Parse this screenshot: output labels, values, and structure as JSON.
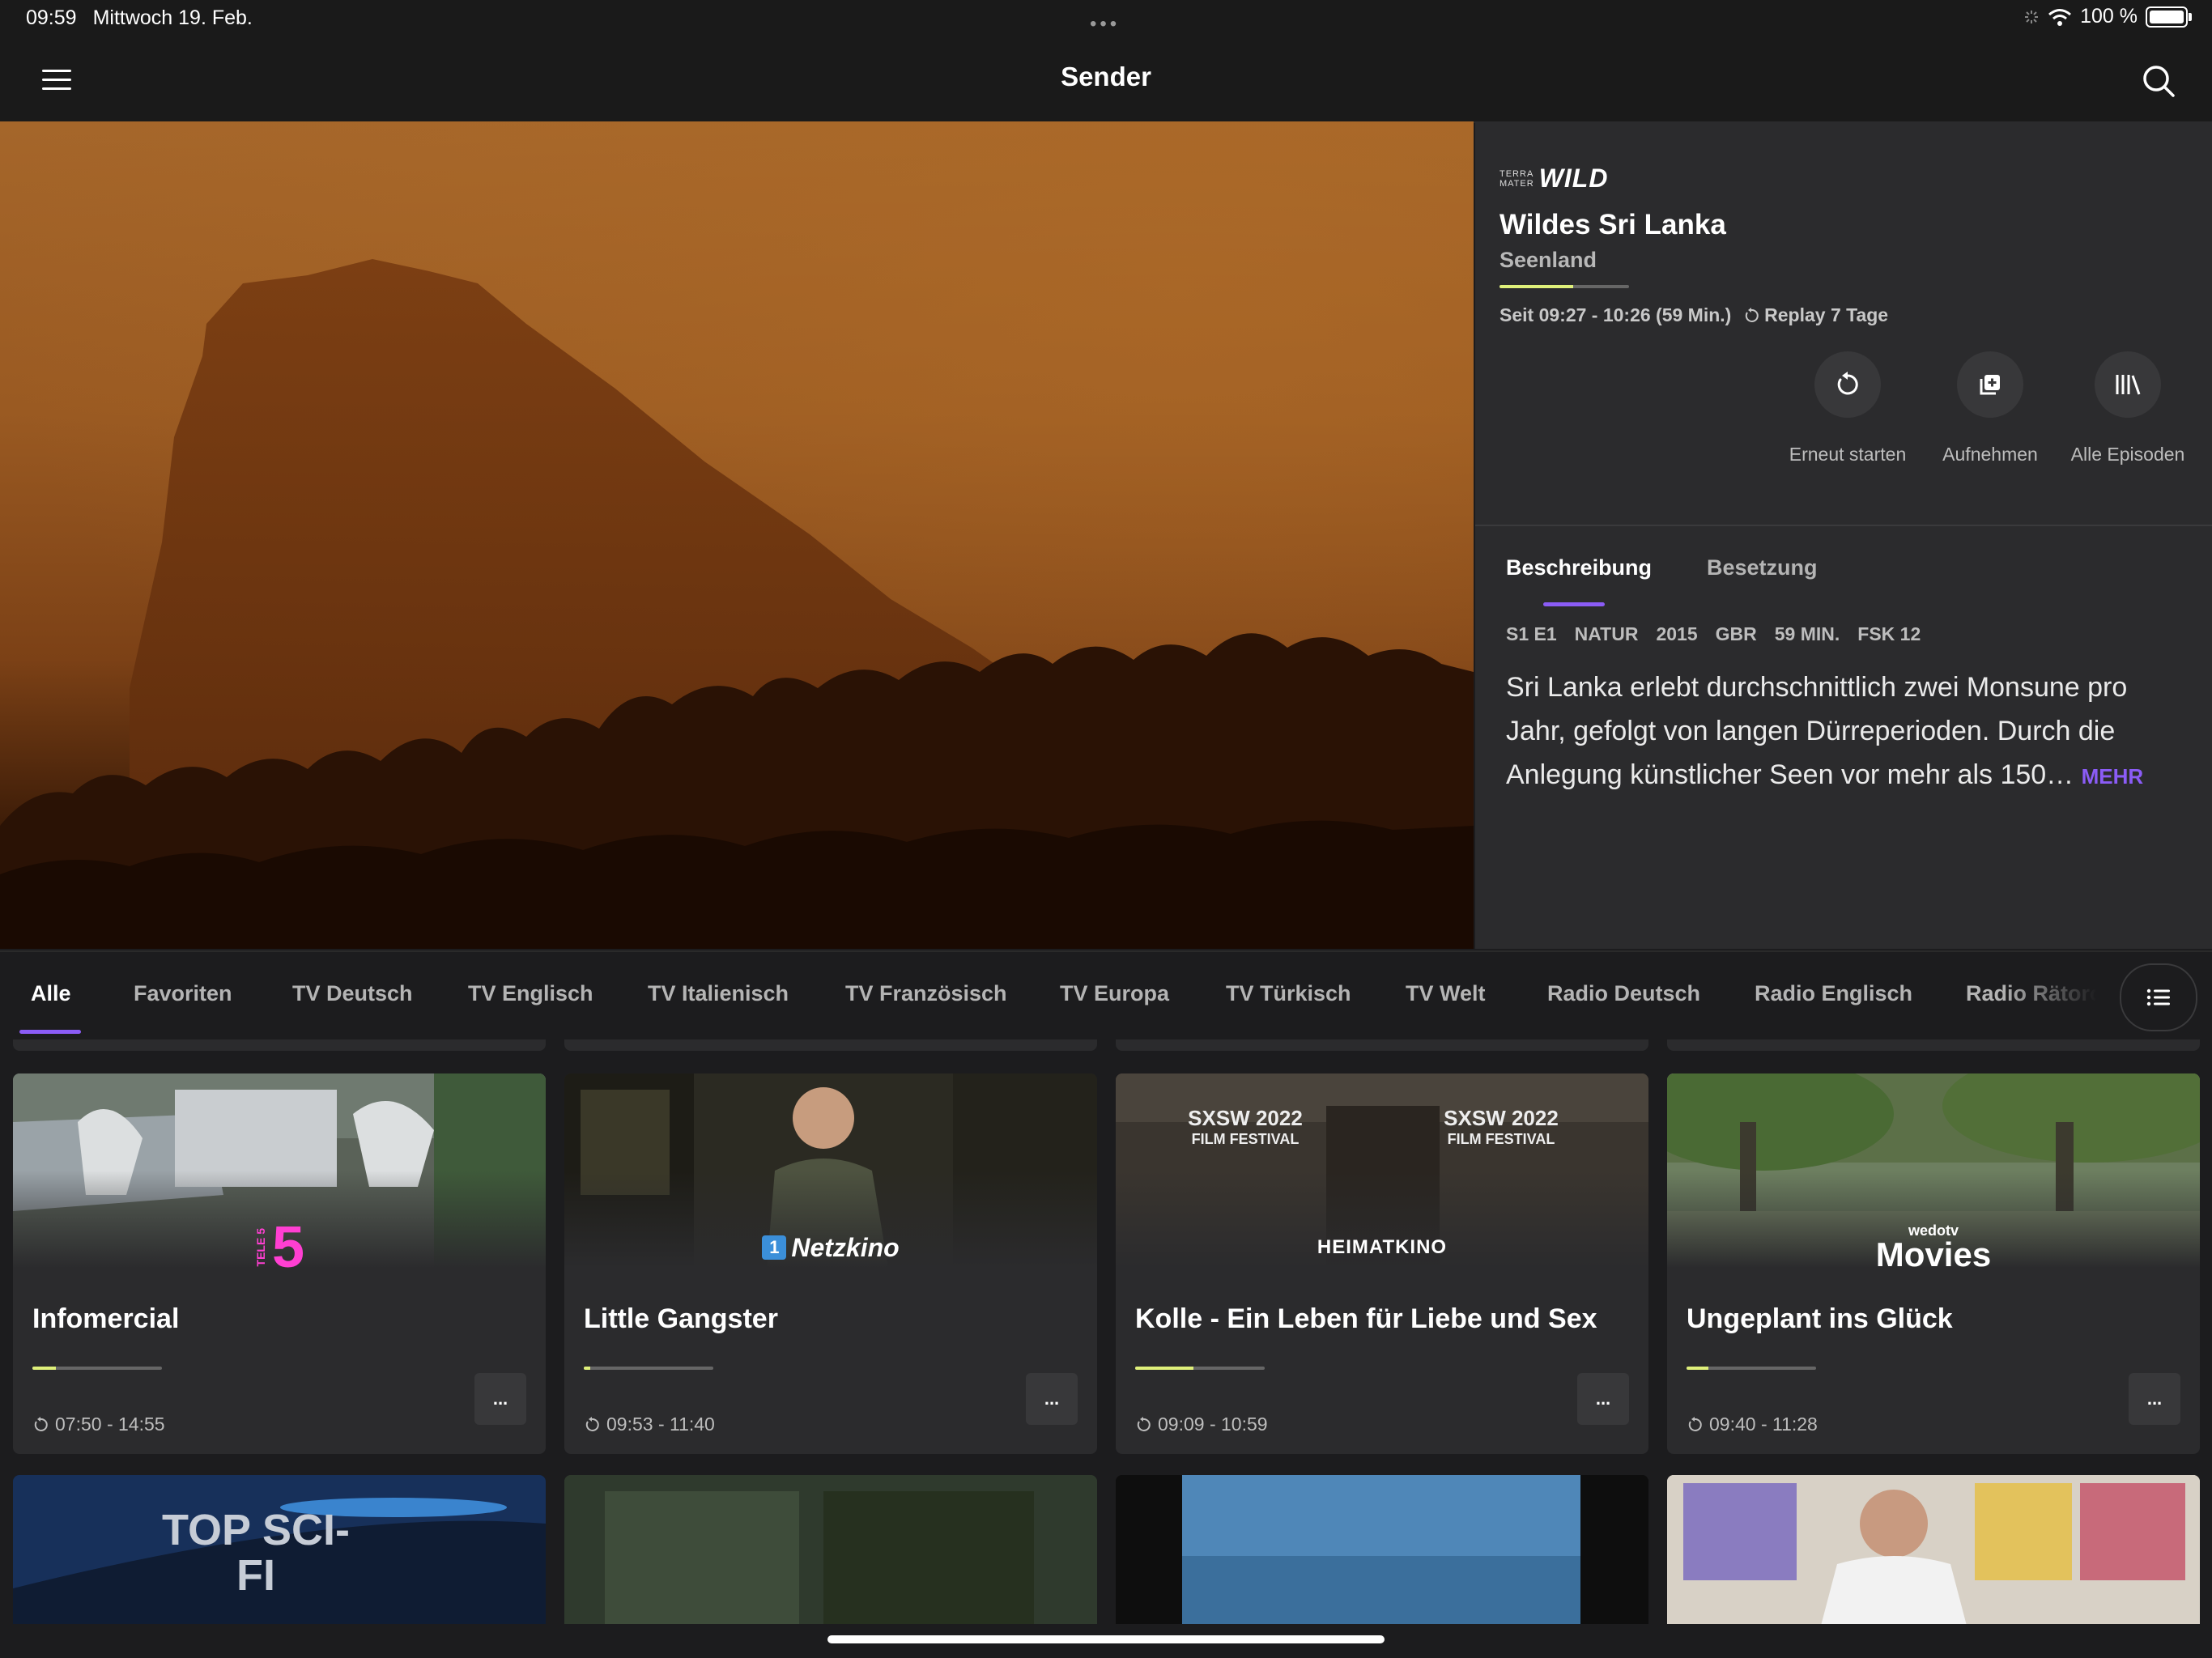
{
  "status_bar": {
    "time": "09:59",
    "date": "Mittwoch 19. Feb.",
    "dots": "•••",
    "battery": "100 %"
  },
  "header": {
    "title": "Sender"
  },
  "program": {
    "channel_logo_small_1": "TERRA",
    "channel_logo_small_2": "MATER",
    "channel_logo_big": "WILD",
    "title": "Wildes Sri Lanka",
    "subtitle": "Seenland",
    "progress": 0.57,
    "time": "Seit 09:27 - 10:26 (59 Min.)",
    "replay": "Replay 7 Tage",
    "actions": [
      {
        "label": "Erneut starten",
        "icon": "restart-icon"
      },
      {
        "label": "Aufnehmen",
        "icon": "record-icon"
      },
      {
        "label": "Alle Episoden",
        "icon": "library-icon"
      }
    ],
    "tabs": [
      {
        "label": "Beschreibung",
        "active": true
      },
      {
        "label": "Besetzung",
        "active": false
      }
    ],
    "meta": [
      "S1 E1",
      "NATUR",
      "2015",
      "GBR",
      "59 MIN.",
      "FSK 12"
    ],
    "description": "Sri Lanka erlebt durchschnittlich zwei Monsune pro Jahr, gefolgt von langen Dürreperioden. Durch die Anlegung künstlicher Seen vor mehr als 150…",
    "more": "MEHR"
  },
  "categories": [
    "Alle",
    "Favoriten",
    "TV Deutsch",
    "TV Englisch",
    "TV Italienisch",
    "TV Französisch",
    "TV Europa",
    "TV Türkisch",
    "TV Welt",
    "Radio Deutsch",
    "Radio Englisch",
    "Radio Rätoromanisch"
  ],
  "active_category": "Alle",
  "cards": [
    {
      "title": "Infomercial",
      "time": "07:50 - 14:55",
      "progress": 0.18,
      "channel": "TELE 5",
      "more": "..."
    },
    {
      "title": "Little Gangster",
      "time": "09:53 - 11:40",
      "progress": 0.05,
      "channel": "Netzkino",
      "channel_badge": "1",
      "more": "..."
    },
    {
      "title": "Kolle - Ein Leben für Liebe und Sex",
      "time": "09:09 - 10:59",
      "progress": 0.45,
      "channel": "HEIMATKINO",
      "more": "...",
      "laurel_1": "SXSW 2022",
      "laurel_2": "FILM FESTIVAL"
    },
    {
      "title": "Ungeplant ins Glück",
      "time": "09:40 - 11:28",
      "progress": 0.17,
      "channel": "Movies",
      "channel_small": "wedotv",
      "more": "..."
    }
  ],
  "peek_cards": [
    {
      "title_art": "TOP SCI-FI"
    }
  ],
  "colors": {
    "accent": "#8b5cf6",
    "progress": "#dff07a",
    "panel": "#2b2b2d",
    "background": "#1c1c1e"
  }
}
